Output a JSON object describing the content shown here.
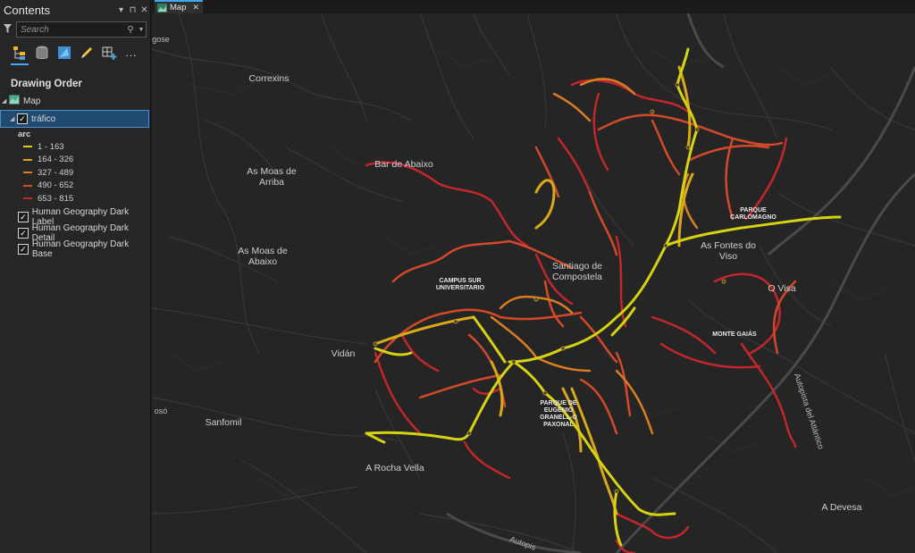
{
  "contents_pane": {
    "title": "Contents",
    "search": {
      "placeholder": "Search",
      "value": ""
    },
    "toolbar_icons": [
      "list-by-drawing-order-icon",
      "list-by-data-source-icon",
      "list-by-selection-icon",
      "list-by-editing-icon",
      "list-by-snapping-icon",
      "more-icon"
    ],
    "more_label": "...",
    "section_title": "Drawing Order",
    "map_node": "Map",
    "layer": {
      "name": "tráfico",
      "checked": true,
      "field": "arc",
      "classes": [
        {
          "label": "1 - 163",
          "color": "#d6d30f"
        },
        {
          "label": "164 - 326",
          "color": "#d9a919"
        },
        {
          "label": "327 - 489",
          "color": "#db7d23"
        },
        {
          "label": "490 - 652",
          "color": "#d4492a"
        },
        {
          "label": "653 - 815",
          "color": "#c3262b"
        }
      ]
    },
    "basemap_layers": [
      {
        "name": "Human Geography Dark Label",
        "checked": true
      },
      {
        "name": "Human Geography Dark Detail",
        "checked": true
      },
      {
        "name": "Human Geography Dark Base",
        "checked": true
      }
    ]
  },
  "map_tab": {
    "label": "Map"
  },
  "map": {
    "places": [
      {
        "name": "Correxins"
      },
      {
        "name": "As Moas de\nArriba"
      },
      {
        "name": "As Moas de\nAbaixo"
      },
      {
        "name": "Bar de Abaixo"
      },
      {
        "name": "Vidán"
      },
      {
        "name": "Sanfomil"
      },
      {
        "name": "A Rocha Vella"
      },
      {
        "name": "Santiago de\nCompostela"
      },
      {
        "name": "As Fontes do\nViso"
      },
      {
        "name": "O Visa"
      },
      {
        "name": "A Devesa"
      },
      {
        "name": "CAMPUS SUR\nUNIVERSITARIO"
      },
      {
        "name": "PARQUE\nCARLOMAGNO"
      },
      {
        "name": "MONTE GAIÁS"
      },
      {
        "name": "PARQUE DE\nEUGENIO\nGRANELL-O\nPAXONAL"
      },
      {
        "name": "Autopista del Atlántico"
      },
      {
        "name": "Autopis"
      },
      {
        "name": "gose"
      },
      {
        "name": "osó"
      }
    ]
  }
}
